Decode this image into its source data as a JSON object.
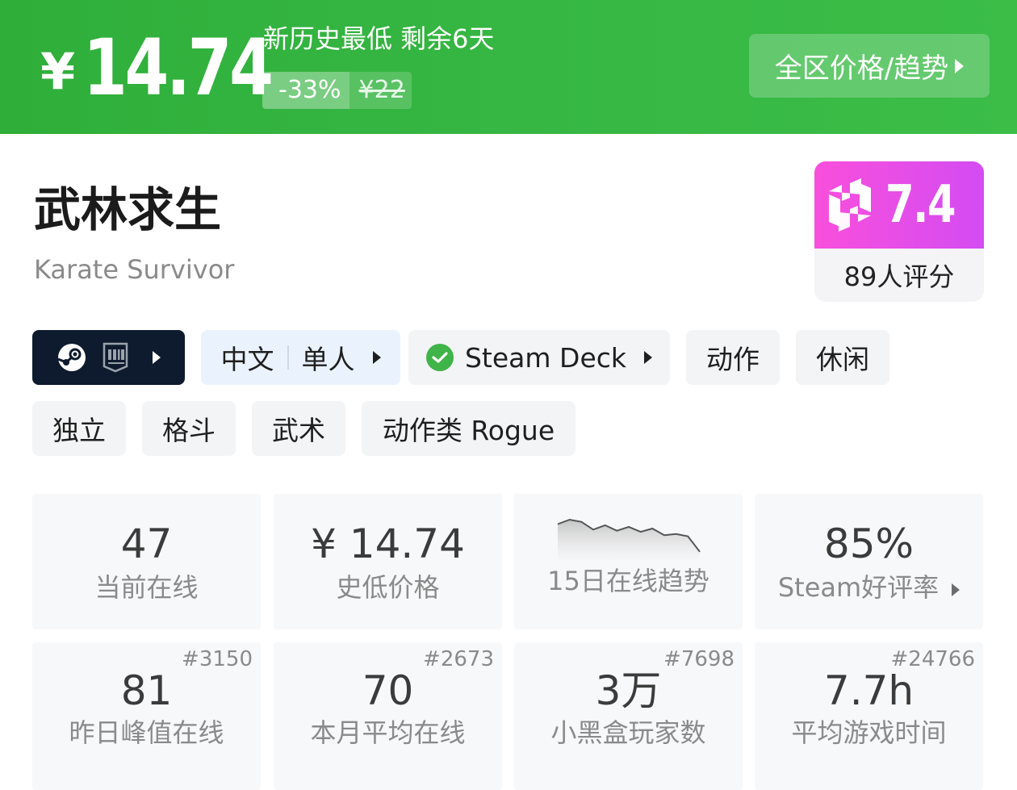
{
  "banner": {
    "currency": "¥",
    "price": "14.74",
    "deal_text": "新历史最低 剩余6天",
    "discount": "-33%",
    "original_price": "¥22",
    "region_button": "全区价格/趋势",
    "colors": {
      "background": "#37b844"
    }
  },
  "game": {
    "title": "武林求生",
    "subtitle": "Karate Survivor"
  },
  "score": {
    "value": "7.4",
    "raters": "89人评分",
    "icon": "heybox-logo-icon",
    "colors": {
      "gradient_start": "#f94fdc",
      "gradient_end": "#d34cf2"
    }
  },
  "tags": {
    "platform": {
      "icons": [
        "steam-icon",
        "epic-games-icon"
      ]
    },
    "language": {
      "lang": "中文",
      "mode": "单人"
    },
    "deck": {
      "label": "Steam Deck",
      "icon": "check-icon"
    },
    "genres": [
      "动作",
      "休闲",
      "独立",
      "格斗",
      "武术",
      "动作类 Rogue"
    ]
  },
  "stats": {
    "online": {
      "value": "47",
      "label": "当前在线"
    },
    "low_price": {
      "value": "¥ 14.74",
      "label": "史低价格"
    },
    "trend": {
      "label": "15日在线趋势",
      "points": [
        62,
        70,
        66,
        52,
        60,
        50,
        57,
        48,
        54,
        42,
        44,
        40,
        12
      ]
    },
    "rating": {
      "value": "85%",
      "label": "Steam好评率"
    },
    "peak": {
      "value": "81",
      "label": "昨日峰值在线",
      "rank": "#3150"
    },
    "month_avg": {
      "value": "70",
      "label": "本月平均在线",
      "rank": "#2673"
    },
    "players": {
      "value": "3万",
      "label": "小黑盒玩家数",
      "rank": "#7698"
    },
    "playtime": {
      "value": "7.7h",
      "label": "平均游戏时间",
      "rank": "#24766"
    }
  }
}
